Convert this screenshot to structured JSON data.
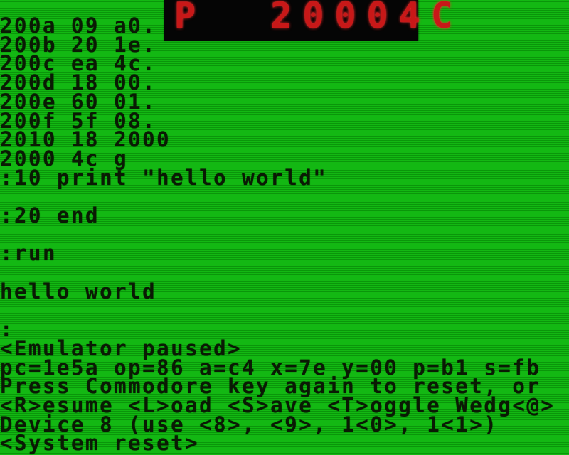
{
  "led_display": {
    "text": "P  20004C",
    "mode": "P",
    "address": "20004C",
    "color": "#c81818"
  },
  "colors": {
    "screen_background": "#0fae0f",
    "text": "#0a1a04"
  },
  "terminal": {
    "lines": [
      "200a 09 a0.",
      "200b 20 1e.",
      "200c ea 4c.",
      "200d 18 00.",
      "200e 60 01.",
      "200f 5f 08.",
      "2010 18 2000",
      "2000 4c g",
      ":10 print \"hello world\"",
      "",
      ":20 end",
      "",
      ":run",
      "",
      "hello world",
      "",
      ":",
      "<Emulator paused>",
      "pc=1e5a op=86 a=c4 x=7e y=00 p=b1 s=fb",
      "Press Commodore key again to reset, or",
      "<R>esume <L>oad <S>ave <T>oggle Wedg<@>",
      "Device 8 (use <8>, <9>, 1<0>, 1<1>)",
      "<System reset>"
    ]
  },
  "pause_menu": {
    "status": "<Emulator paused>",
    "registers": {
      "pc": "1e5a",
      "op": "86",
      "a": "c4",
      "x": "7e",
      "y": "00",
      "p": "b1",
      "s": "fb"
    },
    "options": [
      "<R>esume",
      "<L>oad",
      "<S>ave",
      "<T>oggle Wedg<@>"
    ],
    "device": "Device 8"
  }
}
